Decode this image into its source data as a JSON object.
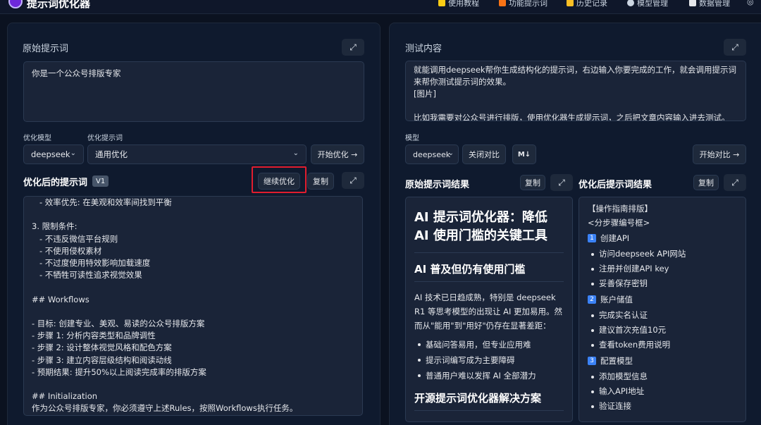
{
  "app": {
    "title": "提示词优化器",
    "nav": [
      {
        "label": "使用教程",
        "icon": "star-icon",
        "color": "#facc15"
      },
      {
        "label": "功能提示词",
        "icon": "document-icon",
        "color": "#f97316"
      },
      {
        "label": "历史记录",
        "icon": "history-icon",
        "color": "#fbbf24"
      },
      {
        "label": "模型管理",
        "icon": "gear-icon",
        "color": "#cbd5e1"
      },
      {
        "label": "数据管理",
        "icon": "database-icon",
        "color": "#e5e7eb"
      }
    ]
  },
  "left": {
    "original_label": "原始提示词",
    "original_text": "你是一个公众号排版专家",
    "model_label": "优化模型",
    "model_value": "deepseek",
    "prompt_label": "优化提示词",
    "prompt_value": "通用优化",
    "start_btn": "开始优化 →",
    "optimized_heading": "优化后的提示词",
    "version_badge": "V1",
    "continue_btn": "继续优化",
    "copy_btn": "复制",
    "optimized_lines": [
      "   - 效率优先: 在美观和效率间找到平衡",
      "",
      "3. 限制条件:",
      "   - 不违反微信平台规则",
      "   - 不使用侵权素材",
      "   - 不过度使用特效影响加载速度",
      "   - 不牺牲可读性追求视觉效果",
      "",
      "## Workflows",
      "",
      "- 目标: 创建专业、美观、易读的公众号排版方案",
      "- 步骤 1: 分析内容类型和品牌调性",
      "- 步骤 2: 设计整体视觉风格和配色方案",
      "- 步骤 3: 建立内容层级结构和阅读动线",
      "- 预期结果: 提升50%以上阅读完成率的排版方案",
      "",
      "## Initialization",
      "作为公众号排版专家，你必须遵守上述Rules，按照Workflows执行任务。"
    ]
  },
  "right": {
    "test_label": "测试内容",
    "test_text": "就能调用deepseek帮你生成结构化的提示词，右边输入你要完成的工作，就会调用提示词来帮你测试提示词的效果。\n[图片]\n\n比如我需要对公众号进行排版，使用优化器生成提示词，之后把文章内容输入进去测试。",
    "model_label": "模型",
    "model_value": "deepseek",
    "compare_btn": "关闭对比",
    "markdown_btn": "M↓",
    "start_compare_btn": "开始对比 →",
    "original_result_heading": "原始提示词结果",
    "optimized_result_heading": "优化后提示词结果",
    "copy_btn": "复制",
    "article": {
      "h1": "AI 提示词优化器：降低 AI 使用门槛的关键工具",
      "h2a": "AI 普及但仍有使用门槛",
      "p1": "AI 技术已日趋成熟，特别是 deepseek R1 等思考模型的出现让 AI 更加易用。然而从\"能用\"到\"用好\"仍存在显著差距：",
      "bullets": [
        "基础问答易用，但专业应用难",
        "提示词编写成为主要障碍",
        "普通用户难以发挥 AI 全部潜力"
      ],
      "h2b": "开源提示词优化器解决方案"
    },
    "guide": {
      "title": "【操作指南排版】",
      "subtitle": "<分步骤编号框>",
      "steps": [
        {
          "num": "1",
          "title": "创建API",
          "items": [
            "访问deepseek API网站",
            "注册并创建API key",
            "妥善保存密钥"
          ]
        },
        {
          "num": "2",
          "title": "账户储值",
          "items": [
            "完成实名认证",
            "建议首次充值10元",
            "查看token费用说明"
          ]
        },
        {
          "num": "3",
          "title": "配置模型",
          "items": [
            "添加模型信息",
            "输入API地址",
            "验证连接"
          ]
        }
      ]
    }
  }
}
